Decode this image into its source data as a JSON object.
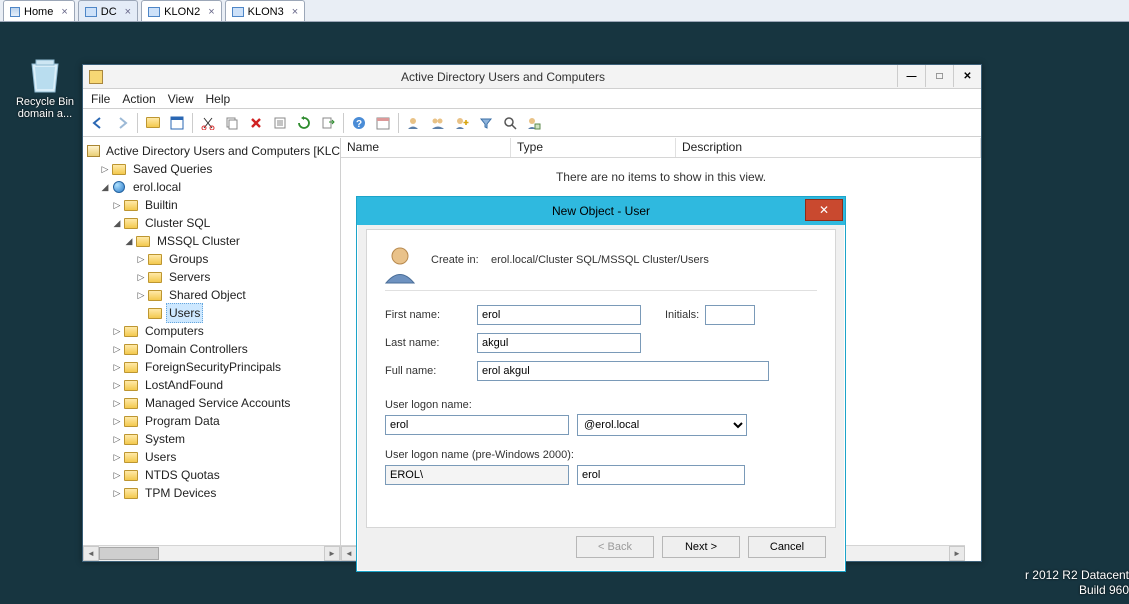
{
  "vtabs": {
    "home": "Home",
    "dc": "DC",
    "klon2": "KLON2",
    "klon3": "KLON3"
  },
  "desktop": {
    "recycle_line1": "Recycle Bin",
    "recycle_line2": "domain a...",
    "watermark_line1": "r 2012 R2 Datacent",
    "watermark_line2": "Build 960"
  },
  "aduc": {
    "title": "Active Directory Users and Computers",
    "menu": {
      "file": "File",
      "action": "Action",
      "view": "View",
      "help": "Help"
    },
    "tree": {
      "root": "Active Directory Users and Computers [KLC",
      "saved": "Saved Queries",
      "domain": "erol.local",
      "builtin": "Builtin",
      "clustersql": "Cluster SQL",
      "mssql": "MSSQL Cluster",
      "groups": "Groups",
      "servers": "Servers",
      "shared": "Shared Object",
      "users_ou": "Users",
      "computers": "Computers",
      "dcs": "Domain Controllers",
      "fsp": "ForeignSecurityPrincipals",
      "laf": "LostAndFound",
      "msa": "Managed Service Accounts",
      "pd": "Program Data",
      "system": "System",
      "users": "Users",
      "ntds": "NTDS Quotas",
      "tpm": "TPM Devices"
    },
    "list": {
      "cols": {
        "name": "Name",
        "type": "Type",
        "desc": "Description"
      },
      "empty": "There are no items to show in this view."
    }
  },
  "dialog": {
    "title": "New Object - User",
    "create_in_label": "Create in:",
    "create_in_path": "erol.local/Cluster SQL/MSSQL Cluster/Users",
    "labels": {
      "first": "First name:",
      "initials": "Initials:",
      "last": "Last name:",
      "full": "Full name:",
      "logon": "User logon name:",
      "logon2k": "User logon name (pre-Windows 2000):"
    },
    "values": {
      "first": "erol",
      "initials": "",
      "last": "akgul",
      "full": "erol akgul",
      "logon": "erol",
      "domain": "@erol.local",
      "netbios": "EROL\\",
      "sam": "erol"
    },
    "buttons": {
      "back": "< Back",
      "next": "Next >",
      "cancel": "Cancel"
    }
  }
}
